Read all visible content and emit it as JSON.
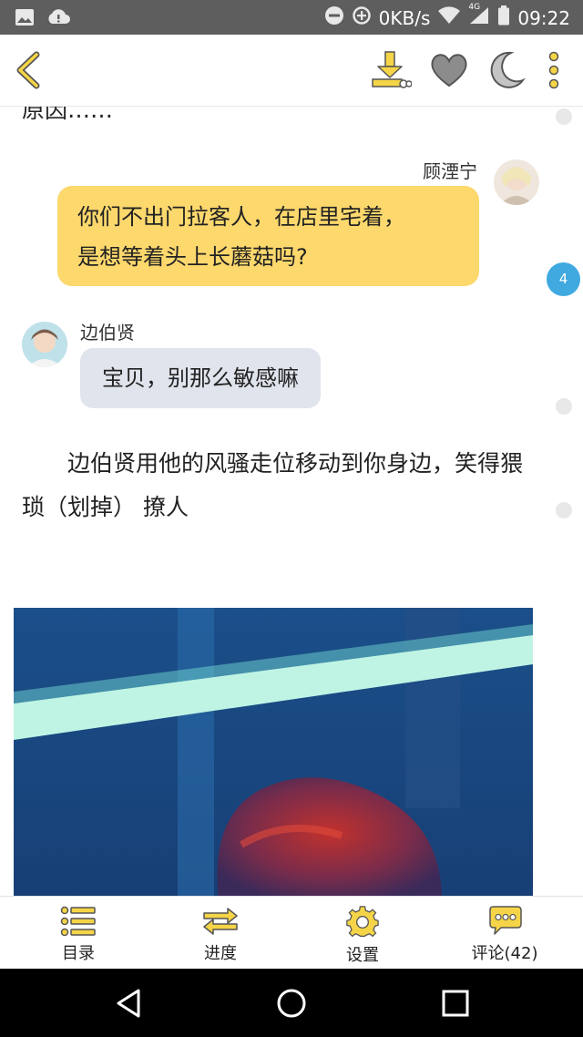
{
  "status_bar": {
    "network_speed": "0KB/s",
    "network_type": "4G",
    "time": "09:22",
    "icons": [
      "image-icon",
      "cloud-alert-icon",
      "do-not-disturb-icon",
      "data-saver-icon",
      "wifi-icon",
      "signal-icon",
      "battery-icon"
    ]
  },
  "top_bar": {
    "icons": [
      "back-arrow-icon",
      "download-icon",
      "heart-icon",
      "moon-icon",
      "more-vertical-icon"
    ],
    "accent_color": "#f5d547"
  },
  "chapter": {
    "cut_text": "原因……",
    "messages": [
      {
        "sender": "顾湮宁",
        "text_line1": "你们不出门拉客人，在店里宅着，",
        "text_line2": "是想等着头上长蘑菇吗?",
        "side": "right",
        "bubble_color": "#fcd86d"
      },
      {
        "sender": "边伯贤",
        "text": "宝贝，别那么敏感嘛",
        "side": "left",
        "bubble_color": "#e0e4ec"
      }
    ],
    "paragraph": "　　边伯贤用他的风骚走位移动到你身边，笑得猥琐（划掉） 撩人",
    "comment_badge": "4"
  },
  "bottom_nav": {
    "items": [
      {
        "label": "目录",
        "icon": "list-icon"
      },
      {
        "label": "进度",
        "icon": "swap-arrows-icon"
      },
      {
        "label": "设置",
        "icon": "gear-icon"
      },
      {
        "label": "评论(42)",
        "icon": "comment-bubble-icon"
      }
    ]
  },
  "system_nav": {
    "icons": [
      "back-triangle-icon",
      "home-circle-icon",
      "recents-square-icon"
    ]
  }
}
